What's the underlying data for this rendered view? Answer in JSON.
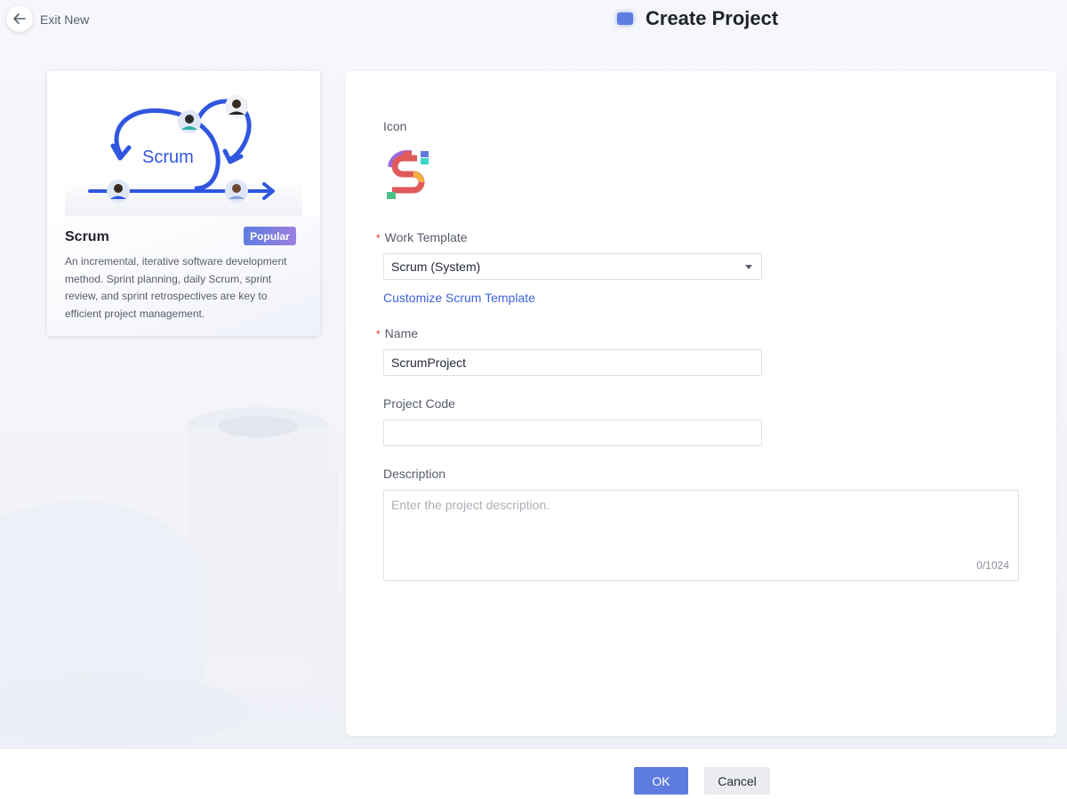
{
  "header": {
    "exit_label": "Exit New",
    "title": "Create Project"
  },
  "template_card": {
    "illustration_text": "Scrum",
    "title": "Scrum",
    "badge": "Popular",
    "description": "An incremental, iterative software development method. Sprint planning, daily Scrum, sprint review, and sprint retrospectives are key to efficient project management."
  },
  "form": {
    "icon_label": "Icon",
    "work_template": {
      "label": "Work Template",
      "value": "Scrum (System)",
      "customize_link": "Customize Scrum Template"
    },
    "name": {
      "label": "Name",
      "value": "ScrumProject"
    },
    "project_code": {
      "label": "Project Code",
      "value": ""
    },
    "description": {
      "label": "Description",
      "placeholder": "Enter the project description.",
      "counter": "0/1024"
    },
    "required_mark": "*"
  },
  "footer": {
    "ok_label": "OK",
    "cancel_label": "Cancel"
  },
  "colors": {
    "primary": "#5e7ce0",
    "link": "#3f63d9",
    "required": "#f23030"
  }
}
